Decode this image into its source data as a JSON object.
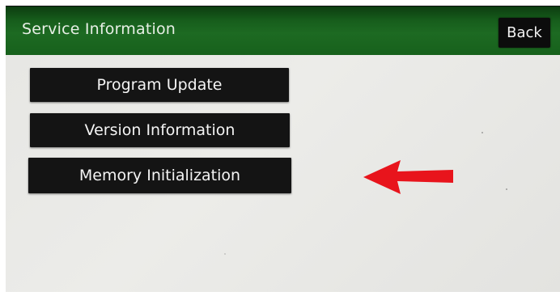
{
  "header": {
    "title": "Service Information",
    "back_label": "Back"
  },
  "menu": {
    "items": [
      {
        "label": "Program Update"
      },
      {
        "label": "Version Information"
      },
      {
        "label": "Memory Initialization"
      }
    ]
  },
  "annotation": {
    "arrow_color": "#e8141c",
    "icon": "arrow-left-icon"
  },
  "colors": {
    "header_green": "#1d6a22",
    "button_black": "#141414",
    "screen_bg": "#e8e8e5"
  }
}
